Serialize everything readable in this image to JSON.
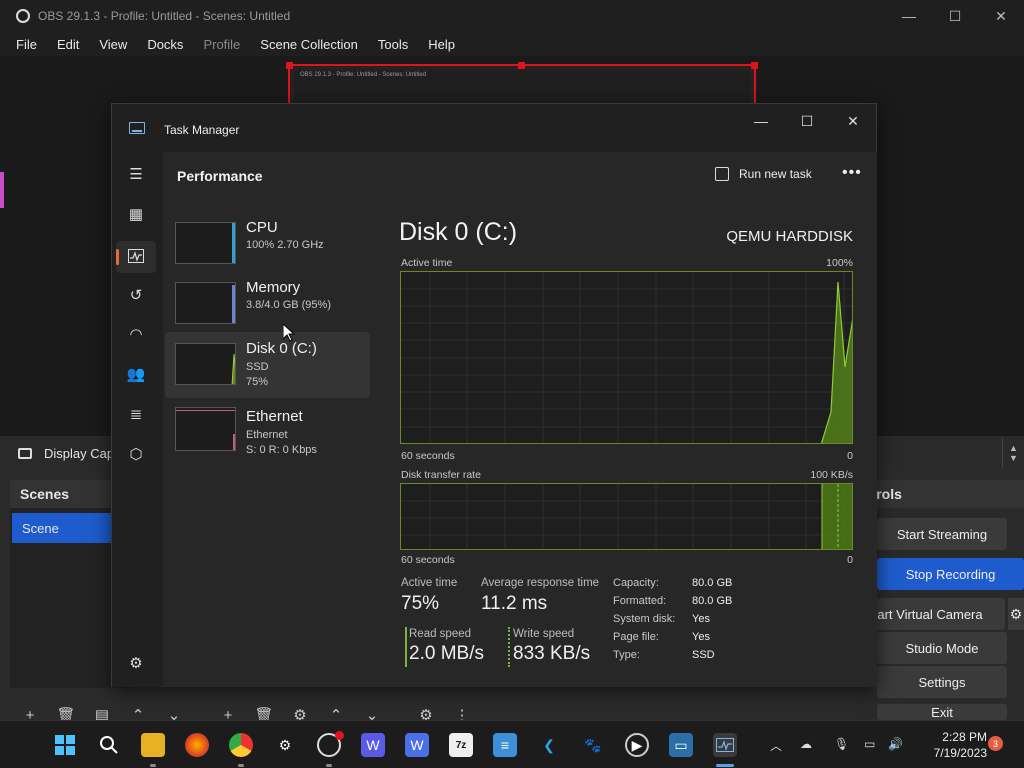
{
  "obs": {
    "title": "OBS 29.1.3 - Profile: Untitled - Scenes: Untitled",
    "menu": [
      "File",
      "Edit",
      "View",
      "Docks",
      "Profile",
      "Scene Collection",
      "Tools",
      "Help"
    ],
    "preview_text": "OBS 29.1.3 - Profile: Untitled - Scenes: Untitled",
    "source_label": "Display Cap",
    "scenes_header": "Scenes",
    "scene_item": "Scene",
    "controls_header": "Controls",
    "controls_header_visible": "ntrols",
    "controls": {
      "start_streaming": "Start Streaming",
      "stop_recording": "Stop Recording",
      "virtual_camera": "art Virtual Camera",
      "studio_mode": "Studio Mode",
      "settings": "Settings",
      "exit": "Exit"
    }
  },
  "task_manager": {
    "title": "Task Manager",
    "page_title": "Performance",
    "run_new_task": "Run new task",
    "items": [
      {
        "name": "CPU",
        "sub1": "100%  2.70 GHz",
        "sub2": "",
        "color": "#2f9fd8"
      },
      {
        "name": "Memory",
        "sub1": "3.8/4.0 GB (95%)",
        "sub2": "",
        "color": "#6a86d0"
      },
      {
        "name": "Disk 0 (C:)",
        "sub1": "SSD",
        "sub2": "75%",
        "color": "#7fb33a"
      },
      {
        "name": "Ethernet",
        "sub1": "Ethernet",
        "sub2": "S: 0  R: 0 Kbps",
        "color": "#c8588a"
      }
    ],
    "detail": {
      "title": "Disk 0 (C:)",
      "model": "QEMU HARDDISK",
      "active_time_label": "Active time",
      "active_time_max": "100%",
      "seconds_label": "60 seconds",
      "zero": "0",
      "transfer_label": "Disk transfer rate",
      "transfer_max": "100 KB/s",
      "stats": {
        "active_time_label": "Active time",
        "active_time": "75%",
        "avg_response_label": "Average response time",
        "avg_response": "11.2 ms",
        "read_label": "Read speed",
        "read": "2.0 MB/s",
        "write_label": "Write speed",
        "write": "833 KB/s"
      },
      "props": [
        {
          "k": "Capacity:",
          "v": "80.0 GB"
        },
        {
          "k": "Formatted:",
          "v": "80.0 GB"
        },
        {
          "k": "System disk:",
          "v": "Yes"
        },
        {
          "k": "Page file:",
          "v": "Yes"
        },
        {
          "k": "Type:",
          "v": "SSD"
        }
      ]
    }
  },
  "taskbar": {
    "time": "2:28 PM",
    "date": "7/19/2023",
    "notifications": "3"
  },
  "accent": {
    "disk": "#7fb33a",
    "obs_blue": "#1e5bcc",
    "obs_red": "#e0121c"
  }
}
